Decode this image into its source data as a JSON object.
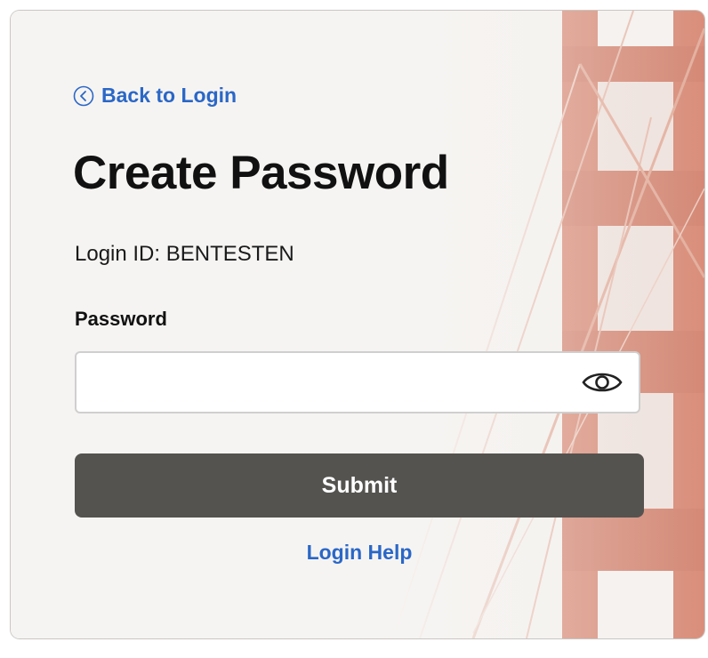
{
  "nav": {
    "back_label": "Back to Login"
  },
  "header": {
    "title": "Create Password"
  },
  "account": {
    "login_id_text": "Login ID: BENTESTEN"
  },
  "form": {
    "password_label": "Password",
    "password_value": "",
    "submit_label": "Submit"
  },
  "footer": {
    "help_label": "Login Help"
  },
  "icons": {
    "back": "chevron-left-circle-icon",
    "reveal": "eye-icon"
  },
  "colors": {
    "link": "#2a67c7",
    "button": "#555350",
    "bridge": "#c9573a",
    "card_bg": "#f6f4f2"
  }
}
